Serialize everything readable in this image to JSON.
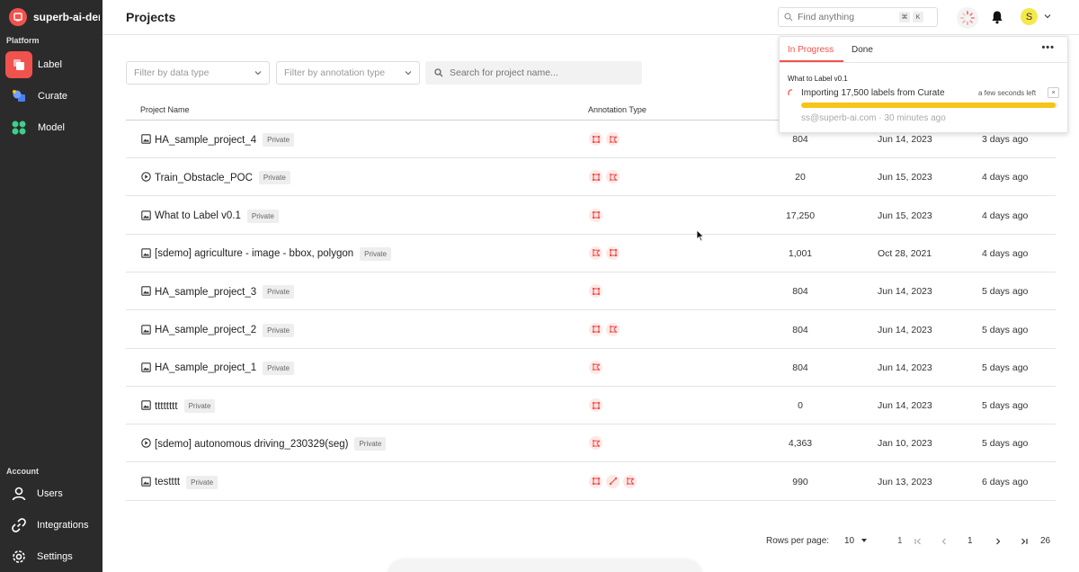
{
  "workspace": {
    "name": "superb-ai-demo"
  },
  "sidebar": {
    "platform_label": "Platform",
    "items": [
      {
        "label": "Label",
        "icon": "label-icon",
        "active": true
      },
      {
        "label": "Curate",
        "icon": "curate-icon",
        "active": false
      },
      {
        "label": "Model",
        "icon": "model-icon",
        "active": false
      }
    ],
    "account_label": "Account",
    "account_items": [
      {
        "label": "Users",
        "icon": "user-icon"
      },
      {
        "label": "Integrations",
        "icon": "link-icon"
      },
      {
        "label": "Settings",
        "icon": "gear-icon"
      }
    ]
  },
  "header": {
    "title": "Projects",
    "search_placeholder": "Find anything",
    "shortcut_keys": [
      "⌘",
      "K"
    ],
    "avatar_initial": "S"
  },
  "filters": {
    "data_type_placeholder": "Filter by data type",
    "annotation_type_placeholder": "Filter by annotation type",
    "search_placeholder": "Search for project name..."
  },
  "table": {
    "columns": [
      "Project Name",
      "Annotation Type"
    ],
    "rows": [
      {
        "type": "image",
        "name": "HA_sample_project_4",
        "badge": "Private",
        "annotations": [
          "box",
          "polygon"
        ],
        "count": "804",
        "created": "Jun 14, 2023",
        "updated": "3 days ago"
      },
      {
        "type": "video",
        "name": "Train_Obstacle_POC",
        "badge": "Private",
        "annotations": [
          "box",
          "polygon"
        ],
        "count": "20",
        "created": "Jun 15, 2023",
        "updated": "4 days ago"
      },
      {
        "type": "image",
        "name": "What to Label v0.1",
        "badge": "Private",
        "annotations": [
          "box"
        ],
        "count": "17,250",
        "created": "Jun 15, 2023",
        "updated": "4 days ago"
      },
      {
        "type": "image",
        "name": "[sdemo] agriculture - image - bbox, polygon",
        "badge": "Private",
        "annotations": [
          "polygon",
          "box"
        ],
        "count": "1,001",
        "created": "Oct 28, 2021",
        "updated": "4 days ago"
      },
      {
        "type": "image",
        "name": "HA_sample_project_3",
        "badge": "Private",
        "annotations": [
          "box"
        ],
        "count": "804",
        "created": "Jun 14, 2023",
        "updated": "5 days ago"
      },
      {
        "type": "image",
        "name": "HA_sample_project_2",
        "badge": "Private",
        "annotations": [
          "box",
          "polygon"
        ],
        "count": "804",
        "created": "Jun 14, 2023",
        "updated": "5 days ago"
      },
      {
        "type": "image",
        "name": "HA_sample_project_1",
        "badge": "Private",
        "annotations": [
          "polygon"
        ],
        "count": "804",
        "created": "Jun 14, 2023",
        "updated": "5 days ago"
      },
      {
        "type": "image",
        "name": "tttttttt",
        "badge": "Private",
        "annotations": [
          "box"
        ],
        "count": "0",
        "created": "Jun 14, 2023",
        "updated": "5 days ago"
      },
      {
        "type": "video",
        "name": "[sdemo] autonomous driving_230329(seg)",
        "badge": "Private",
        "annotations": [
          "polygon"
        ],
        "count": "4,363",
        "created": "Jan 10, 2023",
        "updated": "5 days ago"
      },
      {
        "type": "image",
        "name": "testttt",
        "badge": "Private",
        "annotations": [
          "box",
          "polyline",
          "polygon"
        ],
        "count": "990",
        "created": "Jun 13, 2023",
        "updated": "6 days ago"
      }
    ]
  },
  "pagination": {
    "rows_per_page_label": "Rows per page:",
    "rows_per_page": "10",
    "first_page": "1",
    "current_page": "1",
    "last_page": "26"
  },
  "progress_panel": {
    "tabs": [
      "In Progress",
      "Done"
    ],
    "active_tab": "In Progress",
    "more": "•••",
    "job": {
      "project": "What to Label v0.1",
      "text": "Importing 17,500 labels from Curate",
      "time_left": "a few seconds left",
      "close": "×",
      "progress": 0.99,
      "meta": "ss@superb-ai.com · 30 minutes ago"
    }
  },
  "colors": {
    "accent": "#f0524e",
    "progress": "#f5c518",
    "sidebar": "#2b2b2b"
  }
}
